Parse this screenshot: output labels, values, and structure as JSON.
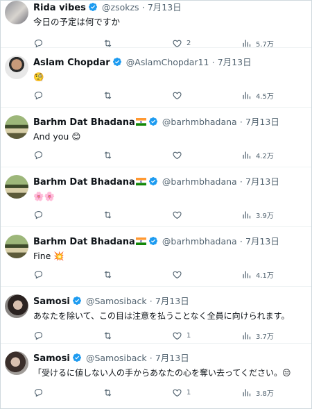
{
  "colors": {
    "verified": "#1d9bf0",
    "text": "#0f1419",
    "muted": "#536471",
    "border": "#eff3f4"
  },
  "tweets": [
    {
      "name": "Rida vibes",
      "handle": "@zsokzs",
      "sep": "·",
      "date": "7月13日",
      "text": "今日の予定は何ですか",
      "replies": "",
      "retweets": "",
      "likes": "2",
      "views": "5.7万",
      "flag": false,
      "avatar_style": "doll"
    },
    {
      "name": "Aslam Chopdar",
      "handle": "@AslamChopdar11",
      "sep": "·",
      "date": "7月13日",
      "text": "",
      "emoji": "🧐",
      "replies": "",
      "retweets": "",
      "likes": "",
      "views": "4.5万",
      "flag": false,
      "avatar_style": "man"
    },
    {
      "name": "Barhm Dat Bhadana",
      "handle": "@barhmbhadana",
      "sep": "·",
      "date": "7月13日",
      "text": "And you",
      "emoji": "😊",
      "replies": "",
      "retweets": "",
      "likes": "",
      "views": "4.2万",
      "flag": true,
      "avatar_style": "landscape"
    },
    {
      "name": "Barhm Dat Bhadana",
      "handle": "@barhmbhadana",
      "sep": "·",
      "date": "7月13日",
      "text": "",
      "emoji": "🌸🌸",
      "replies": "",
      "retweets": "",
      "likes": "",
      "views": "3.9万",
      "flag": true,
      "avatar_style": "landscape"
    },
    {
      "name": "Barhm Dat Bhadana",
      "handle": "@barhmbhadana",
      "sep": "·",
      "date": "7月13日",
      "text": "Fine",
      "emoji": "💥",
      "replies": "",
      "retweets": "",
      "likes": "",
      "views": "4.1万",
      "flag": true,
      "avatar_style": "landscape"
    },
    {
      "name": "Samosi",
      "handle": "@Samosiback",
      "sep": "·",
      "date": "7月13日",
      "text": "あなたを除いて、この目は注意を払うことなく全員に向けられます。",
      "replies": "",
      "retweets": "",
      "likes": "1",
      "views": "3.7万",
      "flag": false,
      "avatar_style": "woman"
    },
    {
      "name": "Samosi",
      "handle": "@Samosiback",
      "sep": "·",
      "date": "7月13日",
      "text": "「受けるに値しない人の手からあなたの心を奪い去ってください。",
      "emoji": "😒",
      "replies": "",
      "retweets": "",
      "likes": "1",
      "views": "3.8万",
      "flag": false,
      "avatar_style": "woman"
    }
  ]
}
